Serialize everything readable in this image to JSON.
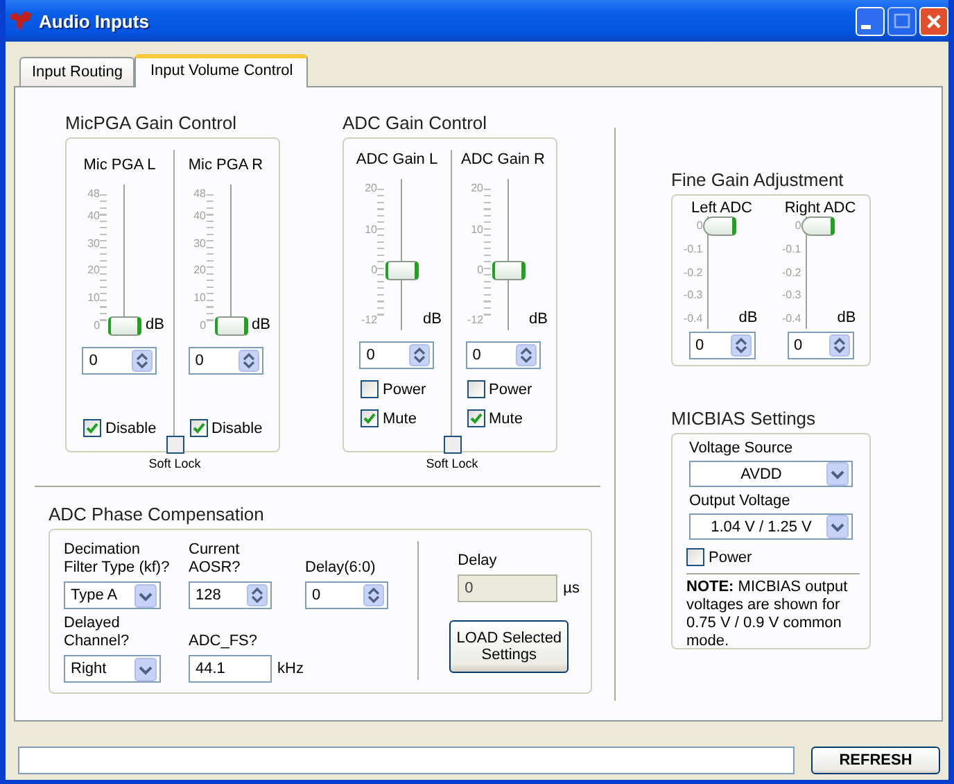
{
  "window": {
    "title": "Audio Inputs"
  },
  "tabs": [
    {
      "label": "Input Routing",
      "selected": false
    },
    {
      "label": "Input Volume Control",
      "selected": true
    }
  ],
  "gain_groups": [
    {
      "title": "MicPGA Gain Control",
      "kind": "mic",
      "channels": [
        {
          "label": "Mic PGA L",
          "ticks": [
            "48",
            "40",
            "30",
            "20",
            "10",
            "0"
          ],
          "unit": "dB",
          "level": 0,
          "value": "0",
          "checkboxes": [
            {
              "label": "Disable",
              "checked": true
            }
          ]
        },
        {
          "label": "Mic PGA R",
          "ticks": [
            "48",
            "40",
            "30",
            "20",
            "10",
            "0"
          ],
          "unit": "dB",
          "level": 0,
          "value": "0",
          "checkboxes": [
            {
              "label": "Disable",
              "checked": true
            }
          ]
        }
      ],
      "soft_lock": {
        "label": "Soft Lock",
        "checked": false
      }
    },
    {
      "title": "ADC Gain Control",
      "kind": "adc",
      "channels": [
        {
          "label": "ADC Gain L",
          "ticks": [
            "20",
            "10",
            "0",
            "-12"
          ],
          "unit": "dB",
          "level": 0.375,
          "value": "0",
          "checkboxes": [
            {
              "label": "Power",
              "checked": false
            },
            {
              "label": "Mute",
              "checked": true
            }
          ]
        },
        {
          "label": "ADC Gain R",
          "ticks": [
            "20",
            "10",
            "0",
            "-12"
          ],
          "unit": "dB",
          "level": 0.375,
          "value": "0",
          "checkboxes": [
            {
              "label": "Power",
              "checked": false
            },
            {
              "label": "Mute",
              "checked": true
            }
          ]
        }
      ],
      "soft_lock": {
        "label": "Soft Lock",
        "checked": false
      }
    }
  ],
  "fine_gain": {
    "title": "Fine Gain Adjustment",
    "channels": [
      {
        "label": "Left ADC",
        "ticks": [
          "0",
          "-0.1",
          "-0.2",
          "-0.3",
          "-0.4"
        ],
        "unit": "dB",
        "level": 1,
        "value": "0"
      },
      {
        "label": "Right ADC",
        "ticks": [
          "0",
          "-0.1",
          "-0.2",
          "-0.3",
          "-0.4"
        ],
        "unit": "dB",
        "level": 1,
        "value": "0"
      }
    ]
  },
  "micbias": {
    "title": "MICBIAS Settings",
    "voltage_source": {
      "label": "Voltage Source",
      "value": "AVDD"
    },
    "output_voltage": {
      "label": "Output Voltage",
      "value": "1.04 V / 1.25 V"
    },
    "power": {
      "label": "Power",
      "checked": false
    },
    "note": "**NOTE:** MICBIAS output voltages are shown for 0.75 V / 0.9 V common mode."
  },
  "phase": {
    "title": "ADC Phase Compensation",
    "fields": [
      {
        "kind": "dropdown",
        "label": "Decimation Filter Type (kf)?",
        "value": "Type A"
      },
      {
        "kind": "spin",
        "label": "Current AOSR?",
        "value": "128"
      },
      {
        "kind": "spin",
        "label": "Delay(6:0)",
        "value": "0"
      },
      {
        "kind": "dropdown",
        "label": "Delayed Channel?",
        "value": "Right"
      },
      {
        "kind": "text",
        "label": "ADC_FS?",
        "value": "44.1",
        "unit": "kHz"
      }
    ],
    "delay": {
      "label": "Delay",
      "value": "0",
      "unit": "µs"
    },
    "load_button": "LOAD Selected Settings"
  },
  "refresh_button": "REFRESH"
}
